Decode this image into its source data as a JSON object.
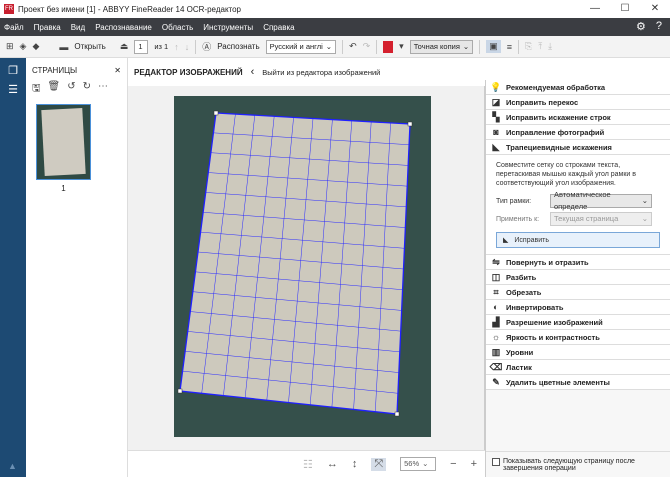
{
  "title": "Проект без имени [1] - ABBYY FineReader 14 OCR-редактор",
  "window_buttons": [
    "—",
    "☐",
    "✕"
  ],
  "menu": [
    "Файл",
    "Правка",
    "Вид",
    "Распознавание",
    "Область",
    "Инструменты",
    "Справка"
  ],
  "toolbar": {
    "open": "Открыть",
    "page": "1",
    "page_of": "из 1",
    "recognize": "Распознать",
    "language": "Русский и англі",
    "mode": "Точная копия"
  },
  "pages_panel": {
    "title": "СТРАНИЦЫ",
    "page_number": "1"
  },
  "editor": {
    "title": "РЕДАКТОР ИЗОБРАЖЕНИЙ",
    "exit": "Выйти из редактора изображений"
  },
  "zoom": "56%",
  "right_panel": {
    "top_items": [
      "Рекомендуемая обработка",
      "Исправить перекос",
      "Исправить искажение строк",
      "Исправление фотографий",
      "Трапециевидные искажения"
    ],
    "description": "Совместите сетку со строками текста, перетаскивая мышью каждый угол рамки в соответствующий угол изображения.",
    "frame_type_label": "Тип рамки:",
    "frame_type_value": "Автоматическое определе",
    "apply_label": "Применить к:",
    "apply_value": "Текущая страница",
    "fix_button": "Исправить",
    "bottom_items": [
      "Повернуть и отразить",
      "Разбить",
      "Обрезать",
      "Инвертировать",
      "Разрешение изображений",
      "Яркость и контрастность",
      "Уровни",
      "Ластик",
      "Удалить цветные элементы"
    ],
    "checkbox": "Показывать следующую страницу после завершения операции"
  },
  "colors": {
    "nav": "#1d4a73",
    "menubar": "#3b3d42",
    "grid": "#2b2bff"
  }
}
